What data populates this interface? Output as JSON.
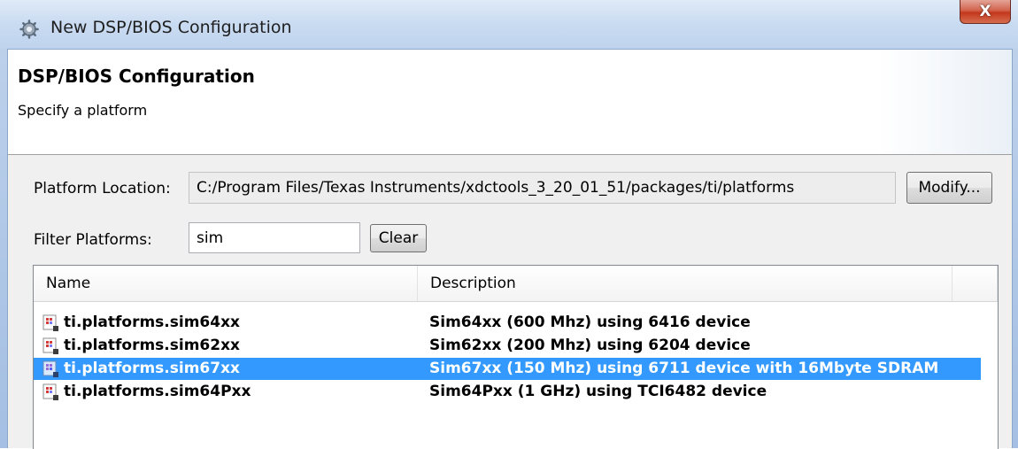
{
  "window": {
    "title": "New DSP/BIOS Configuration",
    "close_label": "X"
  },
  "header": {
    "title": "DSP/BIOS Configuration",
    "subtitle": "Specify a platform"
  },
  "platform_location": {
    "label": "Platform Location:",
    "value": "C:/Program Files/Texas Instruments/xdctools_3_20_01_51/packages/ti/platforms",
    "modify_label": "Modify..."
  },
  "filter": {
    "label": "Filter Platforms:",
    "value": "sim",
    "clear_label": "Clear"
  },
  "table": {
    "columns": [
      "Name",
      "Description"
    ],
    "rows": [
      {
        "name": "ti.platforms.sim64xx",
        "description": "Sim64xx (600 Mhz) using 6416 device",
        "selected": false
      },
      {
        "name": "ti.platforms.sim62xx",
        "description": "Sim62xx (200 Mhz) using 6204 device",
        "selected": false
      },
      {
        "name": "ti.platforms.sim67xx",
        "description": "Sim67xx (150 Mhz) using 6711 device with 16Mbyte SDRAM",
        "selected": true
      },
      {
        "name": "ti.platforms.sim64Pxx",
        "description": "Sim64Pxx (1 GHz) using TCI6482 device",
        "selected": false
      }
    ]
  },
  "colors": {
    "selection": "#3399ff",
    "close_button": "#c4381c"
  }
}
